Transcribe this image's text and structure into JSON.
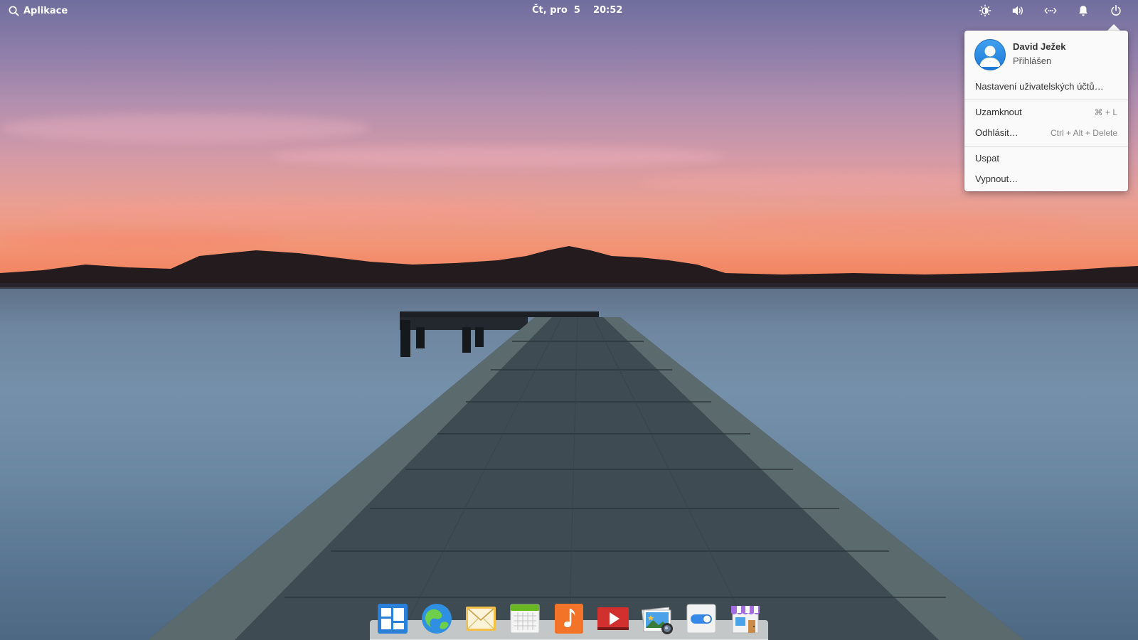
{
  "panel": {
    "applications_label": "Aplikace",
    "date": "Čt, pro  5",
    "time": "20:52",
    "indicators": [
      "brightness-icon",
      "volume-icon",
      "network-icon",
      "notifications-icon",
      "power-icon"
    ]
  },
  "user_menu": {
    "user_name": "David Ježek",
    "user_status": "Přihlášen",
    "account_settings": "Nastavení uživatelských účtů…",
    "lock": {
      "label": "Uzamknout",
      "shortcut": "⌘ + L"
    },
    "logout": {
      "label": "Odhlásit…",
      "shortcut": "Ctrl + Alt + Delete"
    },
    "suspend": "Uspat",
    "shutdown": "Vypnout…"
  },
  "dock": {
    "apps": [
      "multitasking-view-icon",
      "web-browser-icon",
      "mail-icon",
      "calendar-icon",
      "music-icon",
      "videos-icon",
      "photos-icon",
      "system-settings-icon",
      "app-center-icon"
    ]
  },
  "colors": {
    "accent_blue": "#3689e6",
    "popover_bg": "#fafafa"
  }
}
